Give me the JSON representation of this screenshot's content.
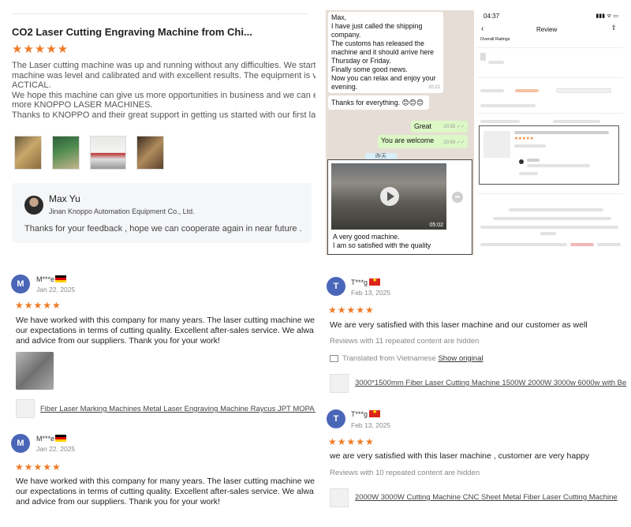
{
  "top_left": {
    "title": "CO2 Laser Cutting Engraving Machine from Chi...",
    "rating_stars": "★★★★★",
    "body_lines": [
      "The Laser cutting machine was up and running without any difficulties. We start c",
      "machine was level and calibrated and with excellent results. The equipment is ver",
      "ACTICAL.",
      "We hope this machine can give us more opportunities in business and we can exp",
      "more KNOPPO LASER MACHINES.",
      "Thanks to KNOPPO and their great support in getting us started with our first lase"
    ],
    "reply": {
      "name": "Max Yu",
      "company": "Jinan Knoppo Automation Equipment Co., Ltd.",
      "message": "Thanks for your feedback , hope we can cooperate again in near future ."
    }
  },
  "chat": {
    "msg1": [
      "Max,",
      "I have just called the shipping",
      "company.",
      "The customs has released the",
      "machine and it should arrive here",
      "Thursday or Friday.",
      "Finally some good news.",
      "Now you can relax and enjoy your",
      "evening."
    ],
    "msg1_time": "20:21",
    "msg2": "Thanks for everything. 😊😊😊",
    "out1": "Great",
    "out1_time": "20:55 ✓✓",
    "out2": "You are welcome",
    "out2_time": "20:59 ✓✓",
    "date_sep": "昨天",
    "video_duration": "05:02",
    "video_caption": [
      "A very good machine.",
      "I am so satisfied with the quality"
    ]
  },
  "mobile": {
    "time": "04:37",
    "signals": "▮▮▮ ᯤ ▭",
    "back_icon": "‹",
    "title": "Review",
    "upload_icon": "⇪",
    "overall": "Overall Ratings"
  },
  "reviews": [
    {
      "initial": "M",
      "user": "M***e",
      "flag": "de",
      "date": "Jan 22, 2025",
      "stars": "★★★★★",
      "lines": [
        "We have worked with this company for many years. The laser cutting machine we",
        "our expectations in terms of cutting quality. Excellent after-sales service. We alwa",
        "and advice from our suppliers. Thank you for your work!"
      ],
      "product": "Fiber Laser Marking Machines Metal Laser Engraving Machine Raycus JPT MOPA MAX"
    },
    {
      "initial": "M",
      "user": "M***e",
      "flag": "de",
      "date": "Jan 22, 2025",
      "stars": "★★★★★",
      "lines": [
        "We have worked with this company for many years. The laser cutting machine we",
        "our expectations in terms of cutting quality. Excellent after-sales service. We alwa",
        "and advice from our suppliers. Thank you for your work!"
      ]
    },
    {
      "initial": "T",
      "user": "T***g",
      "flag": "vn",
      "date": "Feb 13, 2025",
      "stars": "★★★★★",
      "text": "We are very satisfied with this laser machine and our customer as well",
      "hidden": "Reviews with 11 repeated content are hidden",
      "translated": "Translated from Vietnamese",
      "show_original": "Show original",
      "product": "3000*1500mm Fiber Laser Cutting Machine 1500W 2000W 3000w 6000w with Be"
    },
    {
      "initial": "T",
      "user": "T***g",
      "flag": "vn",
      "date": "Feb 13, 2025",
      "stars": "★★★★★",
      "text": "we are very satisfied with this laser machine , customer are very happy",
      "hidden": "Reviews with 10 repeated content are hidden",
      "product": "2000W 3000W Cutting Machine CNC Sheet Metal Fiber Laser Cutting Machine"
    }
  ],
  "colors": {
    "star": "#ef7a26",
    "avatar": "#4a66b8",
    "chat_out": "#dcf8c6",
    "chat_bg": "#e6ded6"
  }
}
